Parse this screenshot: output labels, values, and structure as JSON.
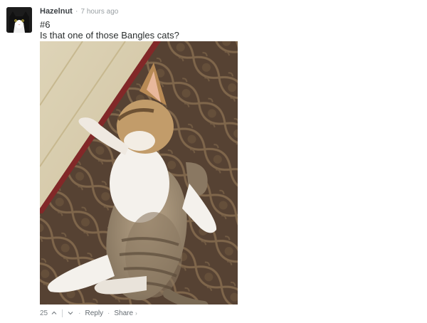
{
  "comment": {
    "author": "Hazelnut",
    "separator": "·",
    "time": "7 hours ago",
    "line1": "#6",
    "line2": "Is that one of those Bangles cats?"
  },
  "footer": {
    "votes": "25",
    "upvote_icon": "chevron-up-icon",
    "downvote_icon": "chevron-down-icon",
    "dot": "·",
    "reply": "Reply",
    "share": "Share",
    "share_chevron": "›"
  },
  "colors": {
    "author": "#3c4145",
    "muted": "#9aa0a4",
    "link": "#656c72"
  }
}
